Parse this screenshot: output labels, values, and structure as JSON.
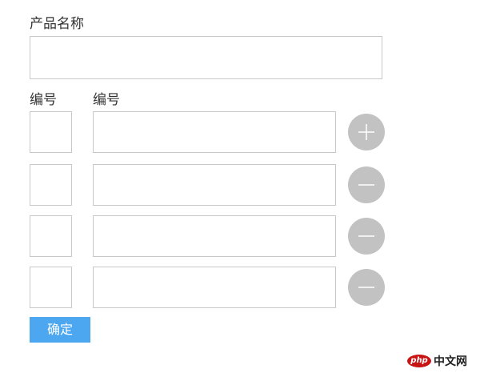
{
  "form": {
    "product_name_label": "产品名称",
    "product_name_value": "",
    "code_label_left": "编号",
    "code_label_right": "编号",
    "rows": [
      {
        "code": "",
        "value": "",
        "action": "add"
      },
      {
        "code": "",
        "value": "",
        "action": "remove"
      },
      {
        "code": "",
        "value": "",
        "action": "remove"
      },
      {
        "code": "",
        "value": "",
        "action": "remove"
      }
    ],
    "submit_label": "确定"
  },
  "watermark": {
    "logo_text": "php",
    "site_text": "中文网"
  },
  "colors": {
    "circle_button": "#c2c2c2",
    "submit_button": "#4da6f0",
    "field_border": "#c8c8c8",
    "watermark_logo": "#c81414"
  },
  "icons": {
    "add": "plus-icon",
    "remove": "minus-icon"
  }
}
